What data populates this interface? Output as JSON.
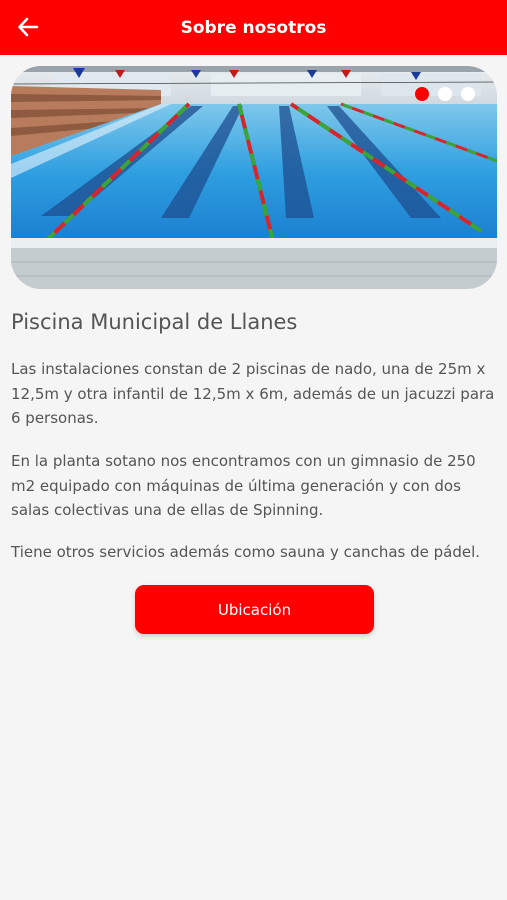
{
  "header": {
    "title": "Sobre nosotros",
    "back_icon": "arrow-left-icon"
  },
  "carousel": {
    "slide_count": 3,
    "active_index": 0,
    "dot_active_color": "#ff0000",
    "dot_color": "#ffffff"
  },
  "main": {
    "title": "Piscina Municipal de Llanes",
    "paragraphs": [
      "Las instalaciones constan de 2 piscinas de nado, una de 25m x 12,5m y otra infantil de 12,5m x 6m, además de un jacuzzi para 6 personas.",
      "En la planta sotano nos encontramos con un gimnasio de 250 m2 equipado con máquinas de última generación y con dos salas colectivas una de ellas de Spinning.",
      "Tiene otros servicios además como sauna y canchas de pádel."
    ],
    "location_button": "Ubicación"
  },
  "colors": {
    "accent": "#ff0000",
    "background": "#f5f5f5",
    "text": "#555555"
  }
}
